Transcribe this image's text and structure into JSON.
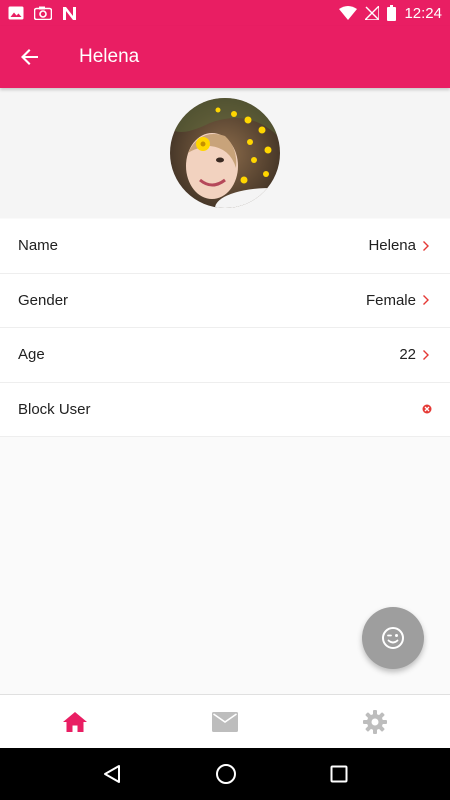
{
  "status_bar": {
    "time": "12:24",
    "icons": [
      "gallery-icon",
      "camera-icon",
      "n-icon",
      "wifi-icon",
      "no-signal-icon",
      "battery-icon"
    ]
  },
  "app_bar": {
    "title": "Helena",
    "back_icon": "arrow-back-icon"
  },
  "profile": {
    "avatar": "profile-photo"
  },
  "rows": [
    {
      "label": "Name",
      "value": "Helena"
    },
    {
      "label": "Gender",
      "value": "Female"
    },
    {
      "label": "Age",
      "value": "22"
    },
    {
      "label": "Block User",
      "value": ""
    }
  ],
  "colors": {
    "primary": "#e91e63",
    "fab": "#9e9e9e",
    "chevron": "#e53935",
    "block_icon": "#e53935",
    "nav_inactive": "#bdbdbd"
  },
  "bottom_nav": {
    "items": [
      "home-icon",
      "mail-icon",
      "settings-icon"
    ],
    "active": "home-icon"
  },
  "fab": {
    "icon": "wink-emoji-icon"
  },
  "system_nav": {
    "items": [
      "back-triangle-icon",
      "home-circle-icon",
      "recents-square-icon"
    ]
  }
}
